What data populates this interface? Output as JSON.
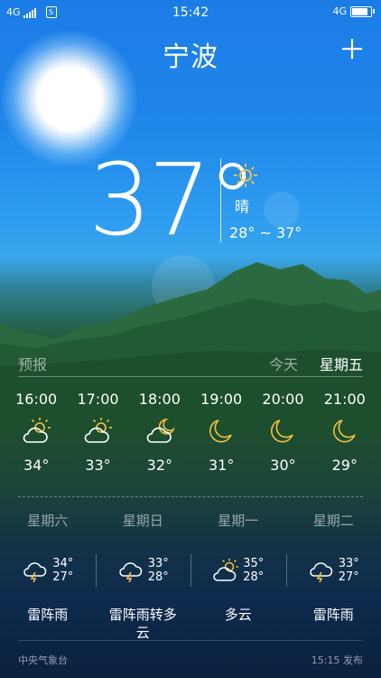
{
  "status_bar": {
    "network_left": "4G",
    "sim_label": "S",
    "time": "15:42",
    "network_right": "4G"
  },
  "header": {
    "city": "宁波",
    "add_label": "+"
  },
  "current": {
    "temperature": "37°",
    "condition": "晴",
    "range": "28° ~ 37°",
    "icon": "sunny-icon"
  },
  "forecast_tabs": {
    "forecast_label": "预报",
    "today_label": "今天",
    "friday_label": "星期五"
  },
  "hourly": [
    {
      "time": "16:00",
      "temp": "34°",
      "icon": "partly-cloudy-day-icon"
    },
    {
      "time": "17:00",
      "temp": "33°",
      "icon": "partly-cloudy-day-icon"
    },
    {
      "time": "18:00",
      "temp": "32°",
      "icon": "partly-cloudy-night-icon"
    },
    {
      "time": "19:00",
      "temp": "31°",
      "icon": "moon-icon"
    },
    {
      "time": "20:00",
      "temp": "30°",
      "icon": "moon-icon"
    },
    {
      "time": "21:00",
      "temp": "29°",
      "icon": "moon-icon"
    }
  ],
  "daily": [
    {
      "day": "星期六",
      "high": "34°",
      "low": "27°",
      "desc": "雷阵雨",
      "icon": "thunderstorm-icon"
    },
    {
      "day": "星期日",
      "high": "33°",
      "low": "28°",
      "desc": "雷阵雨转多云",
      "icon": "thunderstorm-icon"
    },
    {
      "day": "星期一",
      "high": "35°",
      "low": "28°",
      "desc": "多云",
      "icon": "partly-cloudy-day-icon"
    },
    {
      "day": "星期二",
      "high": "33°",
      "low": "27°",
      "desc": "雷阵雨",
      "icon": "thunderstorm-icon"
    }
  ],
  "footer": {
    "source": "中央气象台",
    "published": "15:15 发布"
  },
  "colors": {
    "sky_top": "#1c7ce6",
    "sun_icon": "#f5c342",
    "moon_icon": "#f5c342",
    "lightning": "#f5c342"
  }
}
